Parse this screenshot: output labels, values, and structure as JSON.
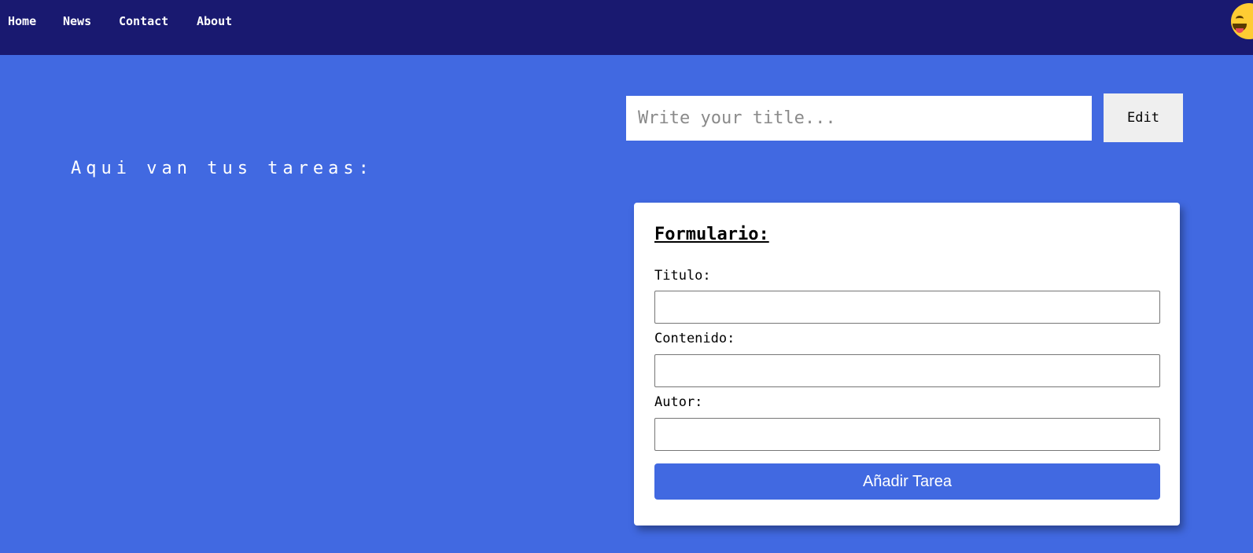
{
  "nav": {
    "items": [
      {
        "label": "Home"
      },
      {
        "label": "News"
      },
      {
        "label": "Contact"
      },
      {
        "label": "About"
      }
    ],
    "avatar_icon": "grinning-tongue-emoji-icon"
  },
  "title_bar": {
    "input_placeholder": "Write your title...",
    "input_value": "",
    "edit_label": "Edit"
  },
  "tasks": {
    "heading": "Aqui van tus tareas:"
  },
  "form": {
    "title": "Formulario:",
    "fields": [
      {
        "label": "Titulo:",
        "value": ""
      },
      {
        "label": "Contenido:",
        "value": ""
      },
      {
        "label": "Autor:",
        "value": ""
      }
    ],
    "submit_label": "Añadir Tarea"
  },
  "colors": {
    "page_background": "#4169e1",
    "navbar_background": "#191970",
    "button_accent": "#4169e1"
  }
}
